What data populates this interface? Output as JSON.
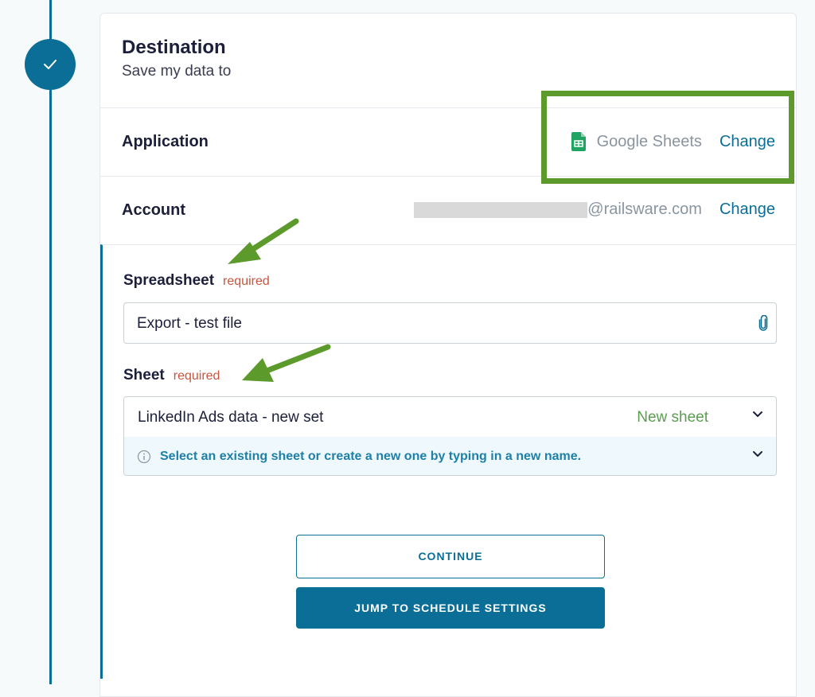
{
  "destination": {
    "title": "Destination",
    "subtitle": "Save my data to"
  },
  "application": {
    "label": "Application",
    "app_name": "Google Sheets",
    "app_icon": "google-sheets-icon",
    "change_label": "Change"
  },
  "account": {
    "label": "Account",
    "email_domain": "@railsware.com",
    "change_label": "Change"
  },
  "spreadsheet": {
    "label": "Spreadsheet",
    "required": "required",
    "value": "Export - test file",
    "icon": "paperclip-icon"
  },
  "sheet": {
    "label": "Sheet",
    "required": "required",
    "value": "LinkedIn Ads data - new set",
    "badge": "New sheet",
    "hint": "Select an existing sheet or create a new one by typing in a new name."
  },
  "buttons": {
    "continue": "CONTINUE",
    "jump": "JUMP TO SCHEDULE SETTINGS"
  },
  "colors": {
    "accent": "#0a6e96",
    "highlight": "#5c9a2c",
    "required": "#c9553f",
    "new_sheet": "#5b9d50"
  }
}
